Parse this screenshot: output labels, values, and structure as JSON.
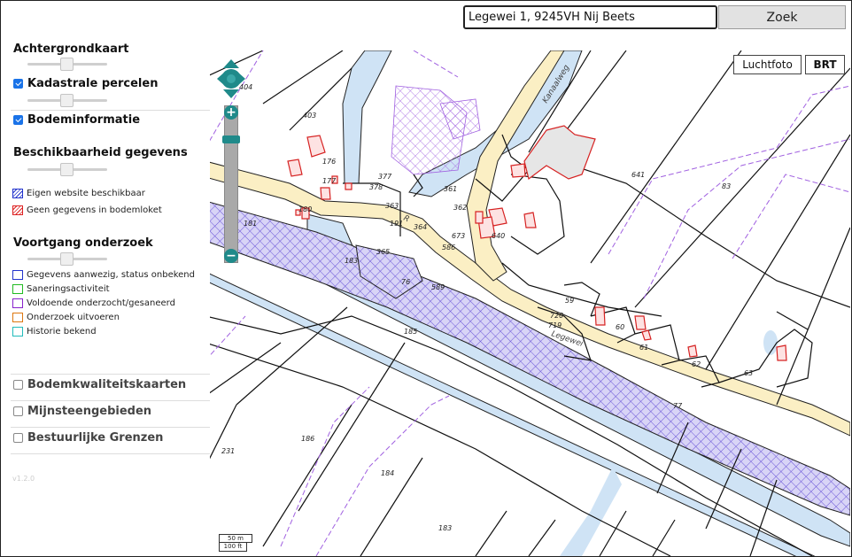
{
  "search": {
    "value": "Legewei 1, 9245VH Nij Beets",
    "button_label": "Zoek"
  },
  "sidebar": {
    "background_map": {
      "title": "Achtergrondkaart",
      "slider_value": 0.5
    },
    "cadastral": {
      "label": "Kadastrale percelen",
      "checked": true,
      "slider_value": 0.5
    },
    "soil_info": {
      "label": "Bodeminformatie",
      "checked": true
    },
    "availability": {
      "title": "Beschikbaarheid gegevens",
      "slider_value": 0.5,
      "legend": [
        {
          "label": "Eigen website beschikbaar",
          "color": "#2233cc"
        },
        {
          "label": "Geen gegevens in bodemloket",
          "color": "#dd2222"
        }
      ]
    },
    "progress": {
      "title": "Voortgang onderzoek",
      "slider_value": 0.5,
      "legend": [
        {
          "label": "Gegevens aanwezig, status onbekend",
          "color": "#2233cc"
        },
        {
          "label": "Saneringsactiviteit",
          "color": "#22bb22"
        },
        {
          "label": "Voldoende onderzocht/gesaneerd",
          "color": "#8822cc"
        },
        {
          "label": "Onderzoek uitvoeren",
          "color": "#dd7711"
        },
        {
          "label": "Historie bekend",
          "color": "#22bbbb"
        }
      ]
    },
    "extra_layers": [
      {
        "label": "Bodemkwaliteitskaarten",
        "checked": false
      },
      {
        "label": "Mijnsteengebieden",
        "checked": false
      },
      {
        "label": "Bestuurlijke Grenzen",
        "checked": false
      }
    ],
    "version": "v1.2.0"
  },
  "map": {
    "background_buttons": [
      {
        "label": "Luchtfoto",
        "active": false
      },
      {
        "label": "BRT",
        "active": true
      }
    ],
    "parcel_numbers": [
      "404",
      "403",
      "176",
      "177",
      "377",
      "378",
      "180",
      "363",
      "191",
      "364",
      "361",
      "362",
      "673",
      "586",
      "640",
      "641",
      "83",
      "181",
      "183",
      "365",
      "76",
      "589",
      "59",
      "720",
      "719",
      "60",
      "61",
      "62",
      "63",
      "185",
      "77",
      "186",
      "231",
      "184",
      "183"
    ],
    "street_labels": [
      "Kanaalweg",
      "Legewei",
      "R"
    ],
    "scale": {
      "metric": "50 m",
      "imperial": "100 ft"
    },
    "zoom": {
      "in": "+",
      "out": "−",
      "level": 0.32
    }
  }
}
